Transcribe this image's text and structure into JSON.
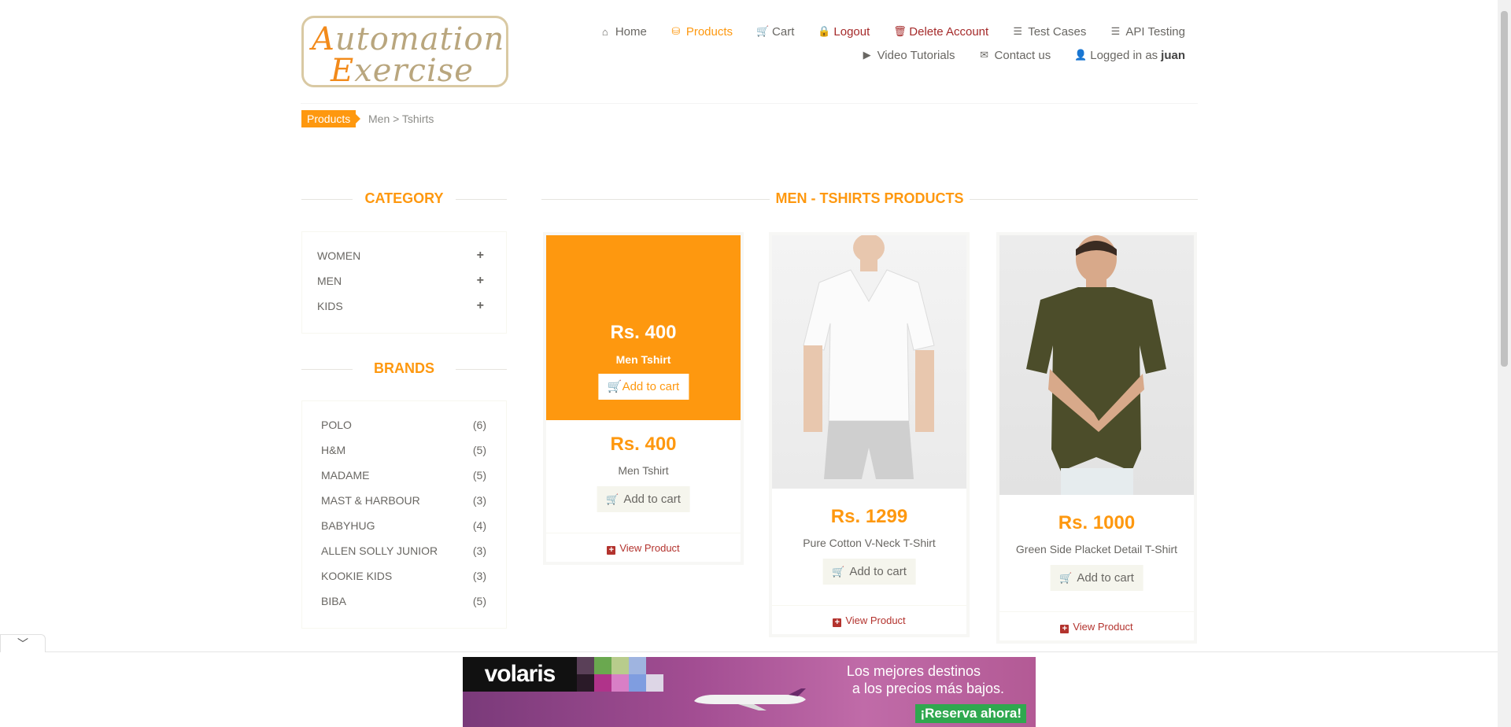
{
  "logo": {
    "line1": "utomation",
    "line1_cap": "A",
    "line2": "xercise",
    "line2_cap": "E"
  },
  "nav": {
    "row1": [
      {
        "label": "Home",
        "icon": "home-icon"
      },
      {
        "label": "Products",
        "icon": "products-icon",
        "active": true
      },
      {
        "label": "Cart",
        "icon": "cart-icon"
      },
      {
        "label": "Logout",
        "icon": "lock-icon"
      },
      {
        "label": "Delete Account",
        "icon": "trash-icon"
      },
      {
        "label": "Test Cases",
        "icon": "list-icon"
      },
      {
        "label": "API Testing",
        "icon": "list-icon"
      }
    ],
    "row2": [
      {
        "label": "Video Tutorials",
        "icon": "youtube-icon"
      },
      {
        "label": "Contact us",
        "icon": "envelope-icon"
      },
      {
        "label": "Logged in as",
        "icon": "user-icon",
        "user": "juan"
      }
    ]
  },
  "breadcrumb": {
    "tag": "Products",
    "path": "Men > Tshirts"
  },
  "sidebar": {
    "category_title": "CATEGORY",
    "categories": [
      {
        "label": "WOMEN",
        "toggle": "+"
      },
      {
        "label": "MEN",
        "toggle": "+"
      },
      {
        "label": "KIDS",
        "toggle": "+"
      }
    ],
    "brands_title": "BRANDS",
    "brands": [
      {
        "label": "POLO",
        "count": "(6)"
      },
      {
        "label": "H&M",
        "count": "(5)"
      },
      {
        "label": "MADAME",
        "count": "(5)"
      },
      {
        "label": "MAST & HARBOUR",
        "count": "(3)"
      },
      {
        "label": "BABYHUG",
        "count": "(4)"
      },
      {
        "label": "ALLEN SOLLY JUNIOR",
        "count": "(3)"
      },
      {
        "label": "KOOKIE KIDS",
        "count": "(3)"
      },
      {
        "label": "BIBA",
        "count": "(5)"
      }
    ]
  },
  "main": {
    "title": "MEN - TSHIRTS PRODUCTS",
    "products": [
      {
        "price": "Rs. 400",
        "name": "Men Tshirt",
        "add_label": "Add to cart",
        "view_label": "View Product",
        "overlay_price": "Rs. 400",
        "overlay_name": "Men Tshirt",
        "overlay_add_label": "Add to cart"
      },
      {
        "price": "Rs. 1299",
        "name": "Pure Cotton V-Neck T-Shirt",
        "add_label": "Add to cart",
        "view_label": "View Product"
      },
      {
        "price": "Rs. 1000",
        "name": "Green Side Placket Detail T-Shirt",
        "add_label": "Add to cart",
        "view_label": "View Product"
      }
    ]
  },
  "ad": {
    "brand": "volaris",
    "slogan_line1": "Los mejores destinos",
    "slogan_line2": "a los precios más bajos.",
    "cta": "¡Reserva ahora!",
    "collapse_icon": "chevron-down-icon"
  },
  "colors": {
    "accent": "#fe980f",
    "danger": "#a52a2a",
    "text": "#696763"
  }
}
